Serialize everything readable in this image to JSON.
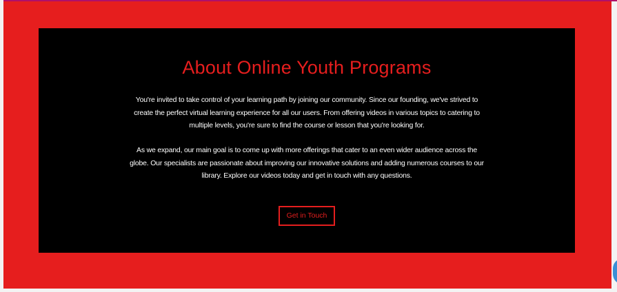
{
  "section": {
    "title": "About Online Youth Programs",
    "paragraph_1": "You're invited to take control of your learning path by joining our community. Since our founding, we've strived to create the perfect virtual learning experience for all our users. From offering videos in various topics to catering to multiple levels, you're sure to find the course or lesson that you're looking for.",
    "paragraph_2": "As we expand, our main goal is to come up with more offerings that cater to an even wider audience across the globe. Our specialists are passionate about improving our innovative solutions and adding numerous courses to our library. Explore our videos today and get in touch with any questions.",
    "cta_label": "Get in Touch"
  },
  "colors": {
    "accent": "#e61e1e",
    "panel": "#000000",
    "text": "#ffffff",
    "top_stripe": "#b0106a",
    "chat_widget": "#3a8fd6"
  },
  "icons": {
    "chat_widget": "chat-icon"
  }
}
